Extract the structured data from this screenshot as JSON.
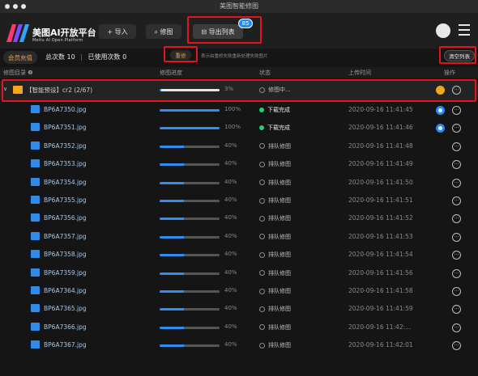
{
  "window": {
    "title": "美图智能修图"
  },
  "brand": {
    "name": "美图AI开放平台",
    "subtitle": "Meitu AI Open Platform"
  },
  "toolbar": {
    "import_label": "+ 导入",
    "fix_label": "⌕ 修图",
    "export_label": "⊟ 导出列表",
    "export_badge": "85"
  },
  "infobar": {
    "vip_label": "会员充值",
    "total_label": "总次数 10",
    "used_label": "已使用次数 0",
    "retry_label": "重修",
    "hint": "表示由重修失败重新处理失败图片",
    "clear_label": "清空列表"
  },
  "table": {
    "headers": [
      "修图目录 ❷",
      "修图进度",
      "状态",
      "上传时间",
      "操作"
    ]
  },
  "group": {
    "name": "【智能预设】cr2  (2/67)",
    "progress": 3,
    "pct_text": "3%",
    "status": "修图中..."
  },
  "rows": [
    {
      "name": "BP6A7350.jpg",
      "progress": 100,
      "pct_text": "100%",
      "status": "下载完成",
      "status_type": "done",
      "time": "2020-09-16 11:41:45",
      "op": "blue"
    },
    {
      "name": "BP6A7351.jpg",
      "progress": 100,
      "pct_text": "100%",
      "status": "下载完成",
      "status_type": "done",
      "time": "2020-09-16 11:41:46",
      "op": "blue"
    },
    {
      "name": "BP6A7352.jpg",
      "progress": 40,
      "pct_text": "40%",
      "status": "排队修图",
      "status_type": "queue",
      "time": "2020-09-16 11:41:48",
      "op": ""
    },
    {
      "name": "BP6A7353.jpg",
      "progress": 40,
      "pct_text": "40%",
      "status": "排队修图",
      "status_type": "queue",
      "time": "2020-09-16 11:41:49",
      "op": ""
    },
    {
      "name": "BP6A7354.jpg",
      "progress": 40,
      "pct_text": "40%",
      "status": "排队修图",
      "status_type": "queue",
      "time": "2020-09-16 11:41:50",
      "op": ""
    },
    {
      "name": "BP6A7355.jpg",
      "progress": 40,
      "pct_text": "40%",
      "status": "排队修图",
      "status_type": "queue",
      "time": "2020-09-16 11:41:51",
      "op": ""
    },
    {
      "name": "BP6A7356.jpg",
      "progress": 40,
      "pct_text": "40%",
      "status": "排队修图",
      "status_type": "queue",
      "time": "2020-09-16 11:41:52",
      "op": ""
    },
    {
      "name": "BP6A7357.jpg",
      "progress": 40,
      "pct_text": "40%",
      "status": "排队修图",
      "status_type": "queue",
      "time": "2020-09-16 11:41:53",
      "op": ""
    },
    {
      "name": "BP6A7358.jpg",
      "progress": 40,
      "pct_text": "40%",
      "status": "排队修图",
      "status_type": "queue",
      "time": "2020-09-16 11:41:54",
      "op": ""
    },
    {
      "name": "BP6A7359.jpg",
      "progress": 40,
      "pct_text": "40%",
      "status": "排队修图",
      "status_type": "queue",
      "time": "2020-09-16 11:41:56",
      "op": ""
    },
    {
      "name": "BP6A7364.jpg",
      "progress": 40,
      "pct_text": "40%",
      "status": "排队修图",
      "status_type": "queue",
      "time": "2020-09-16 11:41:58",
      "op": ""
    },
    {
      "name": "BP6A7365.jpg",
      "progress": 40,
      "pct_text": "40%",
      "status": "排队修图",
      "status_type": "queue",
      "time": "2020-09-16 11:41:59",
      "op": ""
    },
    {
      "name": "BP6A7366.jpg",
      "progress": 40,
      "pct_text": "40%",
      "status": "排队修图",
      "status_type": "queue",
      "time": "2020-09-16 11:42:...",
      "op": ""
    },
    {
      "name": "BP6A7367.jpg",
      "progress": 40,
      "pct_text": "40%",
      "status": "排队修图",
      "status_type": "queue",
      "time": "2020-09-16 11:42:01",
      "op": ""
    }
  ],
  "colors": {
    "accent": "#2f8ef0",
    "highlight": "#e3141c",
    "vip": "#e6a24b",
    "done": "#21d27a"
  }
}
